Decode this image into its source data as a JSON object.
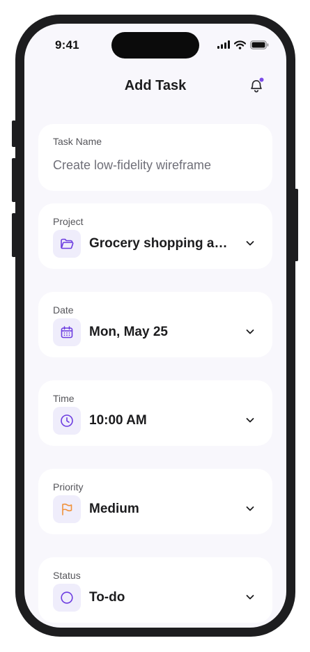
{
  "status_bar": {
    "time": "9:41"
  },
  "header": {
    "title": "Add Task"
  },
  "task_name": {
    "label": "Task Name",
    "value": "Create low-fidelity wireframe"
  },
  "project": {
    "label": "Project",
    "value": "Grocery shopping ap...",
    "icon": "folder-icon"
  },
  "date": {
    "label": "Date",
    "value": "Mon, May 25",
    "icon": "calendar-icon"
  },
  "time": {
    "label": "Time",
    "value": "10:00 AM",
    "icon": "clock-icon"
  },
  "priority": {
    "label": "Priority",
    "value": "Medium",
    "icon": "flag-icon"
  },
  "status": {
    "label": "Status",
    "value": "To-do",
    "icon": "circle-icon"
  },
  "colors": {
    "accent": "#6c3ce0",
    "icon_bg": "#efedfb",
    "priority": "#f0913a",
    "notification_dot": "#7b4be8",
    "background": "#f8f7fc"
  }
}
